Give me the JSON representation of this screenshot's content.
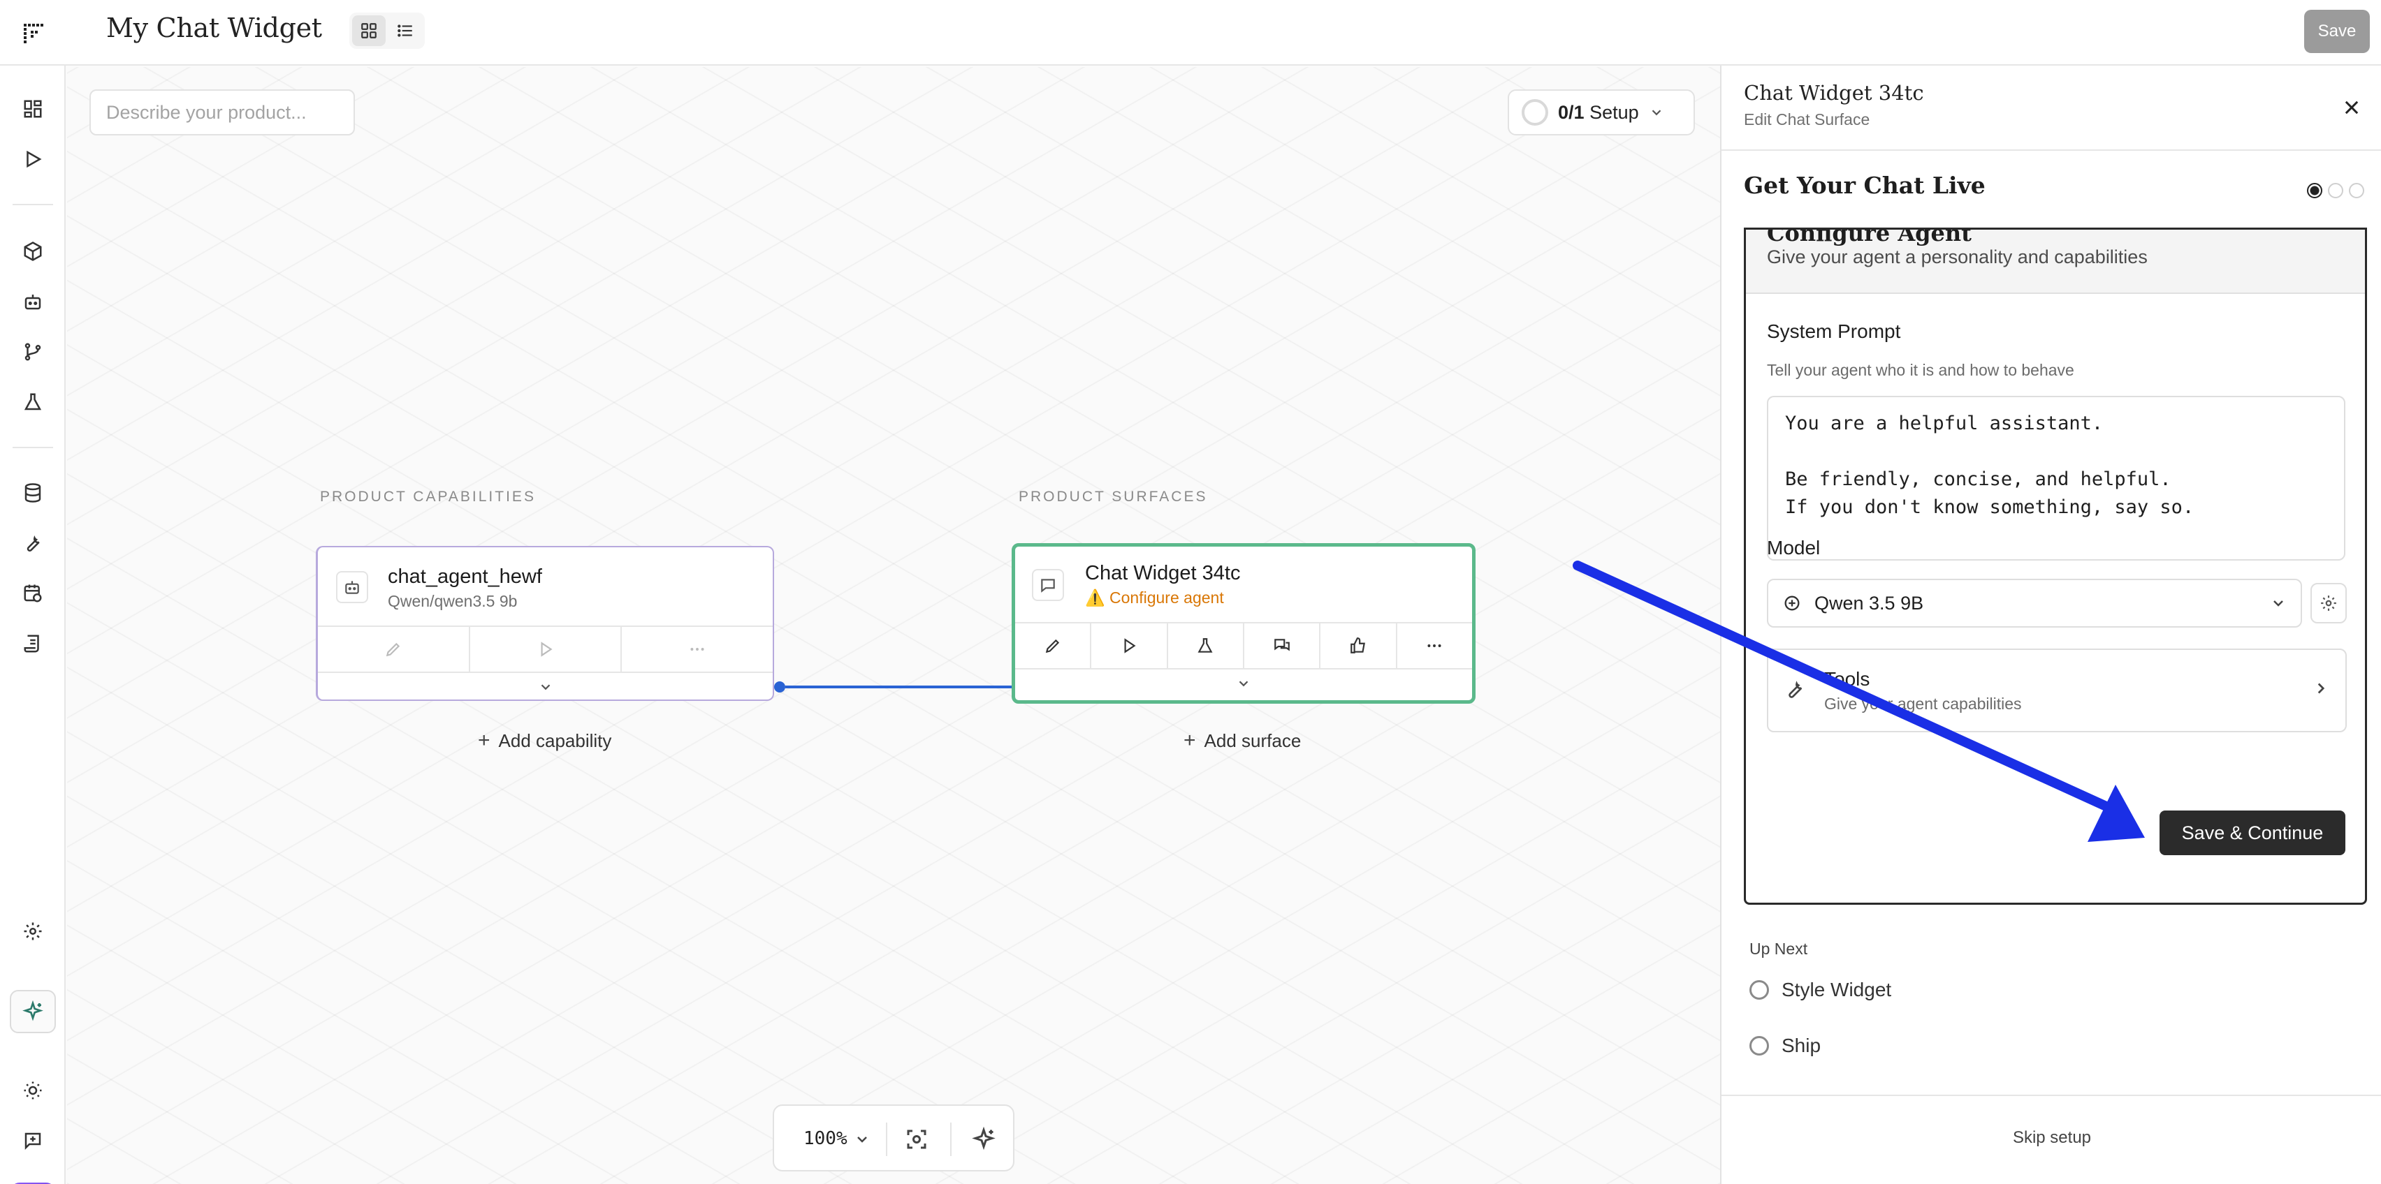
{
  "header": {
    "title": "My Chat Widget",
    "save_label": "Save"
  },
  "canvas": {
    "describe_placeholder": "Describe your product...",
    "setup_count": "0/1",
    "setup_label": "Setup",
    "capabilities_label": "PRODUCT CAPABILITIES",
    "surfaces_label": "PRODUCT SURFACES",
    "capability_node": {
      "title": "chat_agent_hewf",
      "subtitle": "Qwen/qwen3.5 9b"
    },
    "surface_node": {
      "title": "Chat Widget 34tc",
      "warning": "Configure agent"
    },
    "add_capability": "Add capability",
    "add_surface": "Add surface",
    "zoom": "100%"
  },
  "panel": {
    "title": "Chat Widget 34tc",
    "subtitle": "Edit Chat Surface",
    "wizard_title": "Get Your Chat Live",
    "step": {
      "title": "Configure Agent",
      "description": "Give your agent a personality and capabilities",
      "system_prompt_label": "System Prompt",
      "system_prompt_help": "Tell your agent who it is and how to behave",
      "system_prompt_value": "You are a helpful assistant.\n\nBe friendly, concise, and helpful.\nIf you don't know something, say so.",
      "model_label": "Model",
      "model_value": "Qwen 3.5 9B",
      "tools_title": "Tools",
      "tools_sub": "Give your agent capabilities",
      "save_continue": "Save & Continue"
    },
    "up_next_label": "Up Next",
    "up_next": [
      "Style Widget",
      "Ship"
    ],
    "skip_setup": "Skip setup"
  },
  "colors": {
    "accent_blue": "#2a63d4",
    "surface_green": "#5bb98b",
    "warning_orange": "#d97706",
    "capability_border": "#b7a9dd",
    "overlay_arrow": "#1a2fe6"
  }
}
